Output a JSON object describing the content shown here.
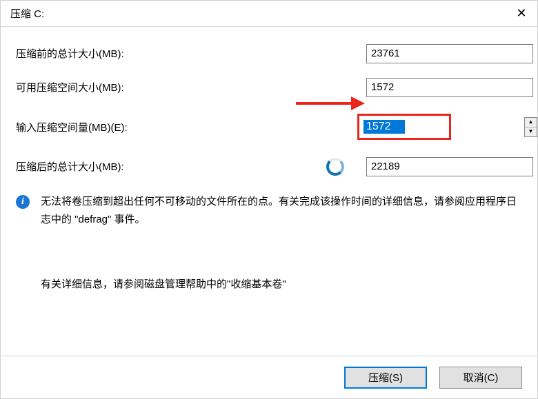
{
  "title": "压缩 C:",
  "labels": {
    "total_before": "压缩前的总计大小(MB):",
    "available": "可用压缩空间大小(MB):",
    "input_amount": "输入压缩空间量(MB)(E):",
    "total_after": "压缩后的总计大小(MB):"
  },
  "values": {
    "total_before": "23761",
    "available": "1572",
    "input_amount": "1572",
    "total_after": "22189"
  },
  "info_text": "无法将卷压缩到超出任何不可移动的文件所在的点。有关完成该操作时间的详细信息，请参阅应用程序日志中的 \"defrag\" 事件。",
  "detail_text": "有关详细信息，请参阅磁盘管理帮助中的\"收缩基本卷\"",
  "buttons": {
    "shrink": "压缩(S)",
    "cancel": "取消(C)"
  }
}
